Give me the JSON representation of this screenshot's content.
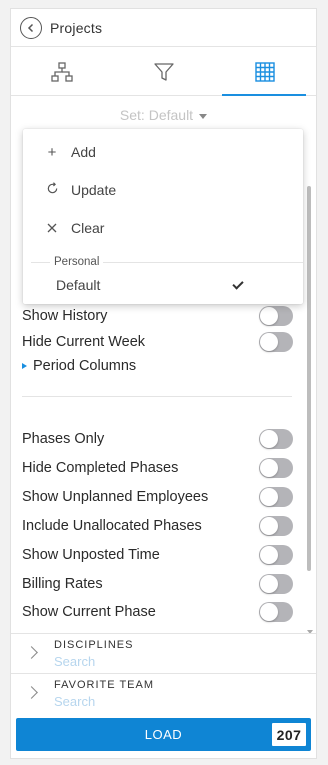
{
  "header": {
    "title": "Projects"
  },
  "tabs": [
    {
      "id": "hierarchy",
      "icon": "sitemap-icon"
    },
    {
      "id": "filter",
      "icon": "filter-icon"
    },
    {
      "id": "grid",
      "icon": "grid-icon",
      "active": true
    }
  ],
  "set_selector": {
    "label": "Set: Default"
  },
  "menu": {
    "items": [
      {
        "label": "Add",
        "icon": "plus-icon"
      },
      {
        "label": "Update",
        "icon": "refresh-icon"
      },
      {
        "label": "Clear",
        "icon": "close-icon"
      }
    ],
    "group_label": "Personal",
    "default_label": "Default"
  },
  "settings": {
    "rows_top": [
      {
        "label": "Show History",
        "on": false
      },
      {
        "label": "Hide Current Week",
        "on": false
      }
    ],
    "period_columns": "Period Columns",
    "rows_bottom": [
      {
        "label": "Phases Only",
        "on": false
      },
      {
        "label": "Hide Completed Phases",
        "on": false
      },
      {
        "label": "Show Unplanned Employees",
        "on": false
      },
      {
        "label": "Include Unallocated Phases",
        "on": false
      },
      {
        "label": "Show Unposted Time",
        "on": false
      },
      {
        "label": "Billing Rates",
        "on": false
      },
      {
        "label": "Show Current Phase",
        "on": false
      }
    ]
  },
  "filters": [
    {
      "title": "DISCIPLINES",
      "placeholder": "Search"
    },
    {
      "title": "FAVORITE TEAM",
      "placeholder": "Search"
    }
  ],
  "load": {
    "label": "LOAD",
    "count": "207"
  },
  "colors": {
    "accent": "#1a8fe0",
    "button": "#0f85d4",
    "toggle_off": "#b4b4b8"
  }
}
